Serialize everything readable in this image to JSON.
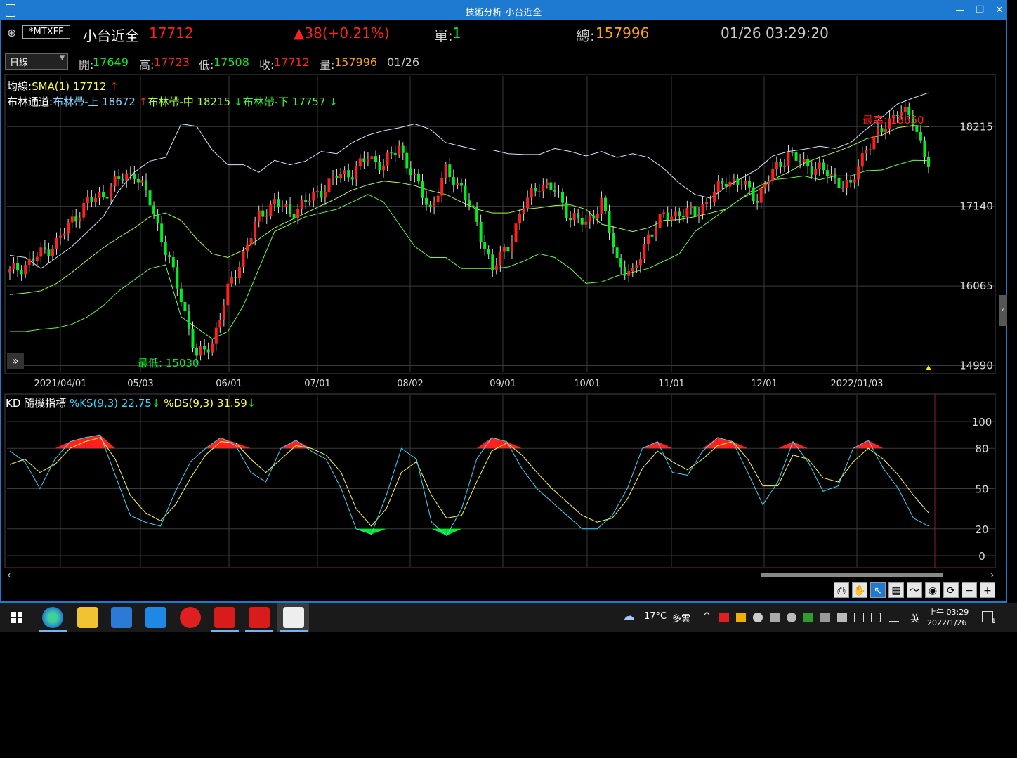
{
  "window": {
    "title": "技術分析-小台近全",
    "minimize": "—",
    "restore": "❐",
    "close": "✕"
  },
  "quote": {
    "add_icon": "⊕",
    "symbol": "*MTXFF",
    "name": "小台近全",
    "last": "17712",
    "change": "▲38(+0.21%)",
    "single_label": "單:",
    "single_value": "1",
    "total_label": "總:",
    "total_value": "157996",
    "datetime": "01/26 03:29:20"
  },
  "ohlc": {
    "period": "日線",
    "open_label": "開:",
    "open": "17649",
    "high_label": "高:",
    "high": "17723",
    "low_label": "低:",
    "low": "17508",
    "close_label": "收:",
    "close": "17712",
    "vol_label": "量:",
    "vol": "157996",
    "date": "01/26"
  },
  "legend": {
    "ma_label": "均線:",
    "sma": "SMA(1) 17712",
    "sma_arrow": "↑",
    "boll_label": "布林通道:",
    "boll_upper": "布林帶-上 18672",
    "boll_upper_arrow": "↑",
    "boll_mid": "布林帶-中 18215",
    "boll_mid_arrow": "↓",
    "boll_lower": "布林帶-下 17757",
    "boll_lower_arrow": "↓"
  },
  "annotations": {
    "max": "最高: 18650",
    "min": "最低: 15030"
  },
  "kd_legend": {
    "title": "KD 隨機指標",
    "ks": "%KS(9,3) 22.75",
    "ks_arrow": "↓",
    "ds": "%DS(9,3) 31.59",
    "ds_arrow": "↓"
  },
  "colors": {
    "up": "#ff2020",
    "down": "#00ee22",
    "boll_upper": "#cfe8ff",
    "boll_mid": "#a8ff3a",
    "boll_lower": "#60ff40",
    "k_line": "#3ad7ff",
    "d_line": "#ffff40",
    "grid": "#3a3a3a",
    "titlebar": "#1e7ad1"
  },
  "chart_data": [
    {
      "type": "candlestick",
      "title": "",
      "x_tick_labels": [
        "2021/04/01",
        "05/03",
        "06/01",
        "07/01",
        "08/02",
        "09/01",
        "10/01",
        "11/01",
        "12/01",
        "2022/01/03"
      ],
      "y_tick_labels": [
        "18215",
        "17140",
        "16065",
        "14990"
      ],
      "ylim": [
        14900,
        18900
      ],
      "max_label_value": 18650,
      "min_label_value": 15030,
      "series": [
        {
          "name": "布林帶-上",
          "values": [
            16480,
            16450,
            16300,
            16450,
            16600,
            16800,
            17000,
            17350,
            17600,
            17750,
            17800,
            18250,
            18220,
            17900,
            17700,
            17700,
            17600,
            17760,
            17700,
            17750,
            17880,
            17850,
            18000,
            18100,
            18160,
            18200,
            18250,
            18180,
            18000,
            17950,
            17900,
            17900,
            17850,
            17840,
            17840,
            17920,
            17880,
            17820,
            17880,
            17800,
            17850,
            17800,
            17650,
            17450,
            17300,
            17250,
            17400,
            17520,
            17640,
            17820,
            17880,
            17910,
            17950,
            17920,
            18000,
            18180,
            18340,
            18520,
            18600,
            18672
          ]
        },
        {
          "name": "布林帶-中",
          "values": [
            15950,
            15970,
            16000,
            16100,
            16250,
            16420,
            16580,
            16720,
            16850,
            17000,
            17050,
            16950,
            16700,
            16500,
            16450,
            16550,
            16700,
            16850,
            16950,
            17050,
            17150,
            17250,
            17360,
            17430,
            17480,
            17460,
            17420,
            17350,
            17300,
            17200,
            17100,
            17050,
            17050,
            17100,
            17120,
            17150,
            17160,
            17100,
            16900,
            16850,
            16800,
            16850,
            16950,
            16960,
            17000,
            17050,
            17100,
            17250,
            17350,
            17500,
            17600,
            17720,
            17800,
            17870,
            17950,
            18050,
            18100,
            18200,
            18230,
            18215
          ]
        },
        {
          "name": "布林帶-下",
          "values": [
            15450,
            15450,
            15480,
            15500,
            15550,
            15650,
            15800,
            16000,
            16150,
            16300,
            16350,
            15650,
            15500,
            15350,
            15450,
            15800,
            16300,
            16800,
            16900,
            17000,
            17050,
            17100,
            17200,
            17300,
            17200,
            16900,
            16600,
            16450,
            16450,
            16300,
            16300,
            16300,
            16320,
            16400,
            16500,
            16450,
            16300,
            16100,
            16120,
            16200,
            16250,
            16300,
            16400,
            16500,
            16800,
            16950,
            17100,
            17250,
            17400,
            17500,
            17520,
            17550,
            17500,
            17550,
            17550,
            17620,
            17630,
            17700,
            17760,
            17757
          ]
        },
        {
          "name": "SMA(1)",
          "values": [
            16250,
            16350,
            16500,
            16650,
            16950,
            17200,
            17300,
            17500,
            17600,
            17200,
            16550,
            15900,
            15100,
            15300,
            16000,
            16500,
            17000,
            17200,
            17050,
            17200,
            17350,
            17550,
            17600,
            17800,
            17700,
            17950,
            17500,
            17100,
            17600,
            17400,
            16900,
            16300,
            16600,
            17150,
            17450,
            17350,
            17000,
            16900,
            17200,
            16400,
            16200,
            16750,
            17000,
            17050,
            17050,
            17250,
            17500,
            17450,
            17250,
            17600,
            17850,
            17700,
            17650,
            17500,
            17400,
            17950,
            18150,
            18450,
            18300,
            17712
          ]
        }
      ]
    },
    {
      "type": "line",
      "title": "KD 隨機指標",
      "x_tick_labels": [
        "2021/04/01",
        "05/03",
        "06/01",
        "07/01",
        "08/02",
        "09/01",
        "10/01",
        "11/01",
        "12/01",
        "2022/01/03"
      ],
      "y_tick_labels": [
        "100",
        "80",
        "50",
        "20",
        "0"
      ],
      "ylim": [
        0,
        100
      ],
      "reference_lines": [
        80,
        20
      ],
      "series": [
        {
          "name": "%KS(9,3)",
          "values": [
            78,
            70,
            50,
            72,
            85,
            88,
            90,
            60,
            30,
            25,
            22,
            48,
            70,
            80,
            88,
            82,
            62,
            55,
            80,
            86,
            78,
            72,
            50,
            20,
            16,
            45,
            80,
            72,
            25,
            15,
            35,
            72,
            88,
            85,
            65,
            50,
            40,
            30,
            20,
            20,
            30,
            50,
            80,
            85,
            62,
            60,
            78,
            88,
            85,
            62,
            38,
            55,
            85,
            70,
            48,
            52,
            80,
            86,
            65,
            50,
            28,
            22
          ]
        },
        {
          "name": "%DS(9,3)",
          "values": [
            68,
            72,
            62,
            68,
            80,
            85,
            88,
            72,
            45,
            32,
            26,
            38,
            58,
            75,
            85,
            84,
            72,
            62,
            72,
            82,
            80,
            75,
            62,
            35,
            22,
            35,
            62,
            70,
            45,
            28,
            30,
            55,
            78,
            84,
            75,
            62,
            50,
            40,
            30,
            25,
            28,
            42,
            65,
            78,
            70,
            64,
            72,
            82,
            85,
            72,
            52,
            52,
            75,
            72,
            58,
            55,
            70,
            80,
            72,
            60,
            45,
            32
          ]
        }
      ]
    }
  ],
  "toolbar": {
    "print": "⎙",
    "hand": "✋",
    "pointer": "↖",
    "table": "▦",
    "chart": "〜",
    "eye": "◉",
    "refresh": "⟳",
    "zoom_out": "−",
    "zoom_in": "+"
  },
  "taskbar": {
    "weather_icon": "☁",
    "temperature": "17°C",
    "weather": "多雲",
    "ime": "英",
    "time": "上午 03:29",
    "date": "2022/1/26",
    "notif": "1"
  }
}
